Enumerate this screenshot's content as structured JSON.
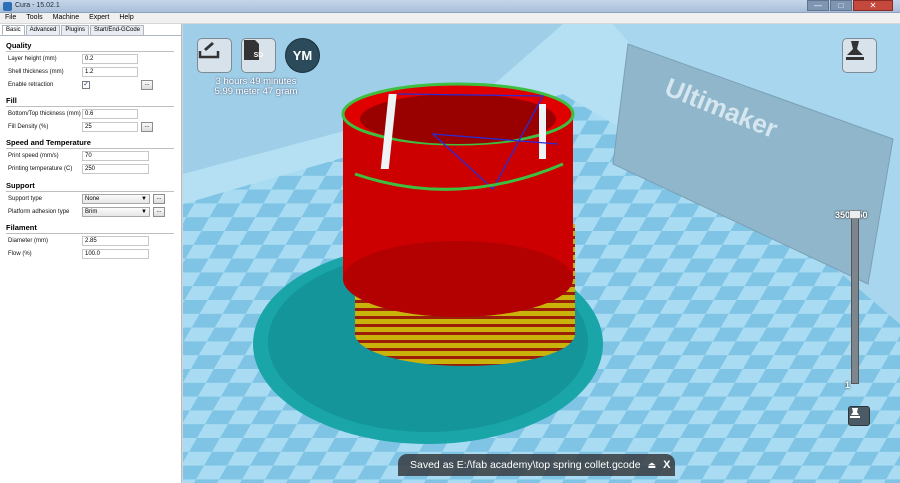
{
  "window": {
    "title": "Cura - 15.02.1",
    "minimize_glyph": "—",
    "maximize_glyph": "□",
    "close_glyph": "✕"
  },
  "menu": [
    "File",
    "Tools",
    "Machine",
    "Expert",
    "Help"
  ],
  "tabs": [
    "Basic",
    "Advanced",
    "Plugins",
    "Start/End-GCode"
  ],
  "sections": {
    "quality": {
      "title": "Quality",
      "layer_height_label": "Layer height (mm)",
      "layer_height": "0.2",
      "shell_label": "Shell thickness (mm)",
      "shell": "1.2",
      "retraction_label": "Enable retraction",
      "retraction_check": "✓"
    },
    "fill": {
      "title": "Fill",
      "bottom_top_label": "Bottom/Top thickness (mm)",
      "bottom_top": "0.6",
      "density_label": "Fill Density (%)",
      "density": "25"
    },
    "speed": {
      "title": "Speed and Temperature",
      "speed_label": "Print speed (mm/s)",
      "speed": "70",
      "temp_label": "Printing temperature (C)",
      "temp": "250"
    },
    "support": {
      "title": "Support",
      "type_label": "Support type",
      "type": "None",
      "adhesion_label": "Platform adhesion type",
      "adhesion": "Brim"
    },
    "filament": {
      "title": "Filament",
      "diameter_label": "Diameter (mm)",
      "diameter": "2.85",
      "flow_label": "Flow (%)",
      "flow": "100.0"
    }
  },
  "more_button_label": "...",
  "viewport": {
    "sd_label": "SD",
    "ym_label": "YM",
    "print_time": "3 hours 49 minutes",
    "print_material": "5.99 meter 47 gram",
    "layer_top": "350",
    "layer_top_right": "350",
    "layer_bottom": "1",
    "brand_text": "Ultimaker",
    "status": "Saved as E:/\\fab academy\\top spring collet.gcode",
    "eject_glyph": "⏏",
    "close_glyph": "X"
  },
  "colors": {
    "bed": "#a9d6ef",
    "model_red": "#cc0000",
    "model_green": "#3fbf3f",
    "brim": "#1aa5a9"
  }
}
